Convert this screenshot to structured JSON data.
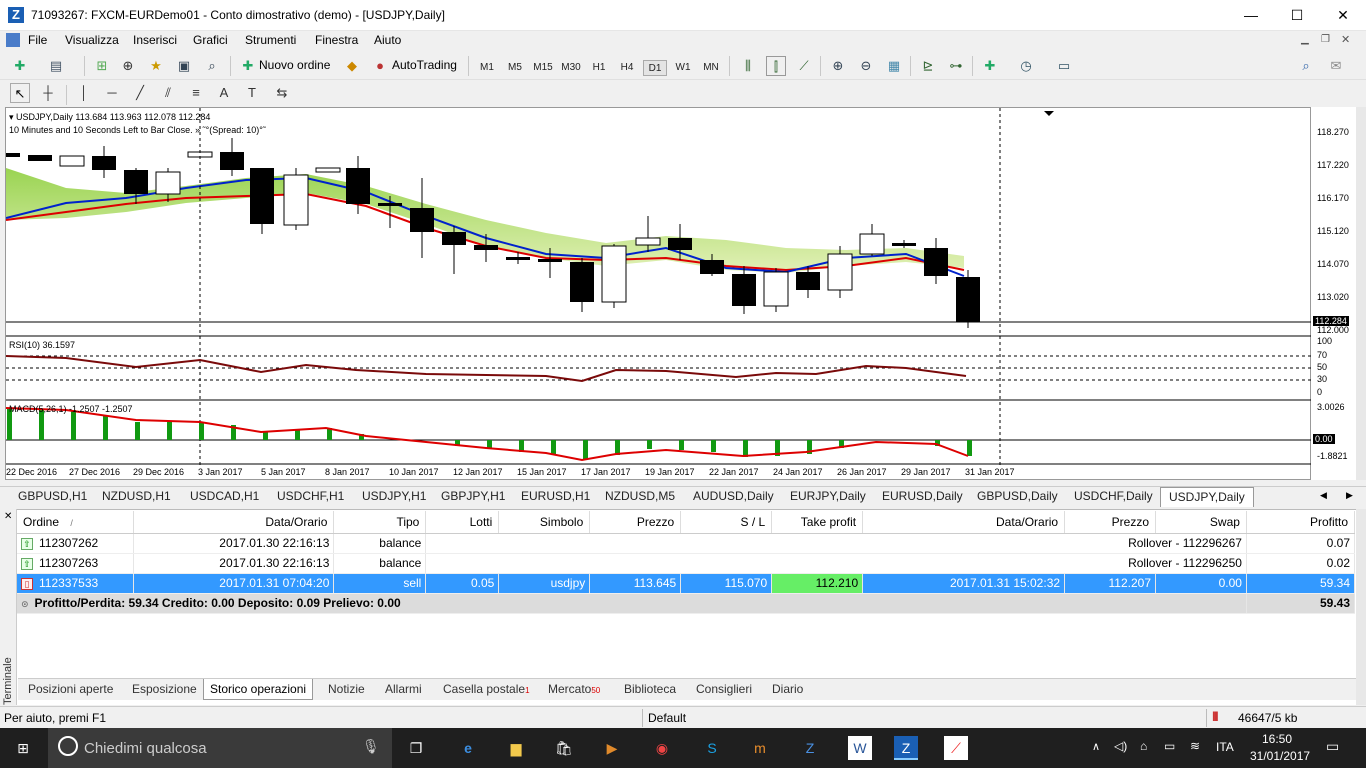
{
  "window": {
    "title": "71093267: FXCM-EURDemo01 - Conto dimostrativo (demo) - [USDJPY,Daily]",
    "minimize": "—",
    "maximize": "☐",
    "close": "✕"
  },
  "menu": [
    "File",
    "Visualizza",
    "Inserisci",
    "Grafici",
    "Strumenti",
    "Finestra",
    "Aiuto"
  ],
  "toolbar": {
    "new_order": "Nuovo ordine",
    "autotrading": "AutoTrading",
    "timeframes": [
      "M1",
      "M5",
      "M15",
      "M30",
      "H1",
      "H4",
      "D1",
      "W1",
      "MN"
    ],
    "active_timeframe": "D1"
  },
  "chart": {
    "header_symbol": "USDJPY,Daily  113.684 113.963 112.078 112.284",
    "header_note": "10 Minutes and 10 Seconds Left to Bar Close. » ˜°(Spread: 10)°˜",
    "rsi_label": "RSI(10) 36.1597",
    "macd_label": "MACD(5,26,1) -1.2507 -1.2507",
    "current_price": "112.284",
    "price_labels": [
      "118.270",
      "117.220",
      "116.170",
      "115.120",
      "114.070",
      "113.020",
      "112.000"
    ],
    "rsi_levels": [
      "100",
      "70",
      "50",
      "30",
      "0"
    ],
    "macd_levels": [
      "3.0026",
      "0.00",
      "-1.8821"
    ],
    "date_labels": [
      "22 Dec 2016",
      "27 Dec 2016",
      "29 Dec 2016",
      "3 Jan 2017",
      "5 Jan 2017",
      "8 Jan 2017",
      "10 Jan 2017",
      "12 Jan 2017",
      "15 Jan 2017",
      "17 Jan 2017",
      "19 Jan 2017",
      "22 Jan 2017",
      "24 Jan 2017",
      "26 Jan 2017",
      "29 Jan 2017",
      "31 Jan 2017"
    ]
  },
  "symbol_tabs": [
    "GBPUSD,H1",
    "NZDUSD,H1",
    "USDCAD,H1",
    "USDCHF,H1",
    "USDJPY,H1",
    "GBPJPY,H1",
    "EURUSD,H1",
    "NZDUSD,M5",
    "AUDUSD,Daily",
    "EURJPY,Daily",
    "EURUSD,Daily",
    "GBPUSD,Daily",
    "USDCHF,Daily",
    "USDJPY,Daily"
  ],
  "active_symbol_tab": "USDJPY,Daily",
  "terminal": {
    "side_label": "Terminale",
    "columns": [
      "Ordine",
      "Data/Orario",
      "Tipo",
      "Lotti",
      "Simbolo",
      "Prezzo",
      "S / L",
      "Take profit",
      "Data/Orario",
      "Prezzo",
      "Swap",
      "Profitto"
    ],
    "sort_mark": "/",
    "rows": [
      {
        "order": "112307262",
        "time": "2017.01.30 22:16:13",
        "type": "balance",
        "comment": "Rollover - 112296267",
        "profit": "0.07"
      },
      {
        "order": "112307263",
        "time": "2017.01.30 22:16:13",
        "type": "balance",
        "comment": "Rollover - 112296250",
        "profit": "0.02"
      }
    ],
    "selected_row": {
      "order": "112337533",
      "time": "2017.01.31 07:04:20",
      "type": "sell",
      "lots": "0.05",
      "symbol": "usdjpy",
      "price": "113.645",
      "sl": "115.070",
      "tp": "112.210",
      "close_time": "2017.01.31 15:02:32",
      "close_price": "112.207",
      "swap": "0.00",
      "profit": "59.34"
    },
    "summary": {
      "text": "Profitto/Perdita: 59.34  Credito: 0.00  Deposito: 0.09  Prelievo: 0.00",
      "total": "59.43"
    }
  },
  "bottom_tabs": [
    {
      "label": "Posizioni aperte",
      "badge": ""
    },
    {
      "label": "Esposizione",
      "badge": ""
    },
    {
      "label": "Storico operazioni",
      "badge": ""
    },
    {
      "label": "Notizie",
      "badge": ""
    },
    {
      "label": "Allarmi",
      "badge": ""
    },
    {
      "label": "Casella postale",
      "badge": "1"
    },
    {
      "label": "Mercato",
      "badge": "50"
    },
    {
      "label": "Biblioteca",
      "badge": ""
    },
    {
      "label": "Consiglieri",
      "badge": ""
    },
    {
      "label": "Diario",
      "badge": ""
    }
  ],
  "active_bottom_tab": "Storico operazioni",
  "status": {
    "help": "Per aiuto, premi F1",
    "profile": "Default",
    "traffic": "46647/5 kb"
  },
  "taskbar": {
    "search_placeholder": "Chiedimi qualcosa",
    "lang": "ITA",
    "time": "16:50",
    "date": "31/01/2017"
  }
}
